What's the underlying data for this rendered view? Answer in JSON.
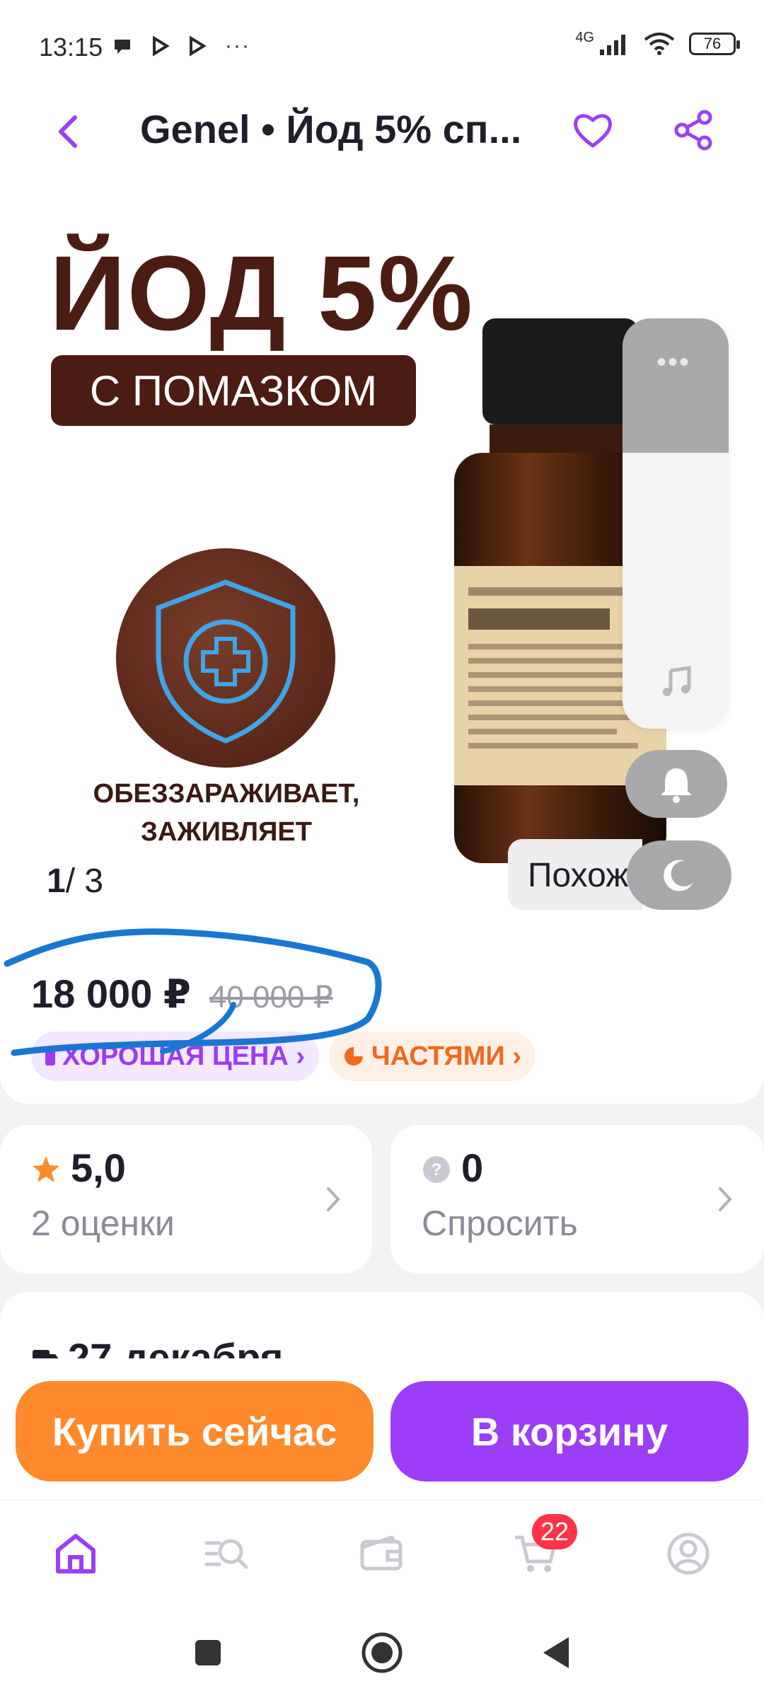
{
  "status_bar": {
    "time": "13:15",
    "network": "4G",
    "battery": "76",
    "icons_left": [
      "chat-bubble-icon",
      "play-icon",
      "play-icon",
      "more-dots"
    ],
    "more": "···"
  },
  "header": {
    "title": "Genel • Йод 5% сп..."
  },
  "gallery": {
    "promo_title": "ЙОД 5%",
    "promo_badge": "С ПОМАЗКОМ",
    "promo_caption_1": "ОБЕЗЗАРАЖИВАЕТ,",
    "promo_caption_2": "ЗАЖИВЛЯЕТ",
    "counter_current": "1",
    "counter_total": "/ 3"
  },
  "floating": {
    "similar_label": "Похож",
    "dots": "•••"
  },
  "price": {
    "current": "18 000 ₽",
    "old": "40 000 ₽",
    "chip_good": "ХОРОШАЯ ЦЕНА ›",
    "chip_parts": "ЧАСТЯМИ ›"
  },
  "rating_card": {
    "value": "5,0",
    "label": "2 оценки"
  },
  "questions_card": {
    "value": "0",
    "label": "Спросить"
  },
  "delivery": {
    "date": "27 декабря"
  },
  "actions": {
    "buy_now": "Купить сейчас",
    "add_to_cart": "В корзину"
  },
  "bottom_nav": {
    "cart_count": "22",
    "items": [
      "home-icon",
      "catalog-search-icon",
      "wallet-icon",
      "cart-icon",
      "profile-icon"
    ]
  },
  "colors": {
    "accent": "#9c3ef7",
    "buy": "#ff8a2c",
    "badge": "#ff3347",
    "promo_brown": "#4a1c12"
  }
}
